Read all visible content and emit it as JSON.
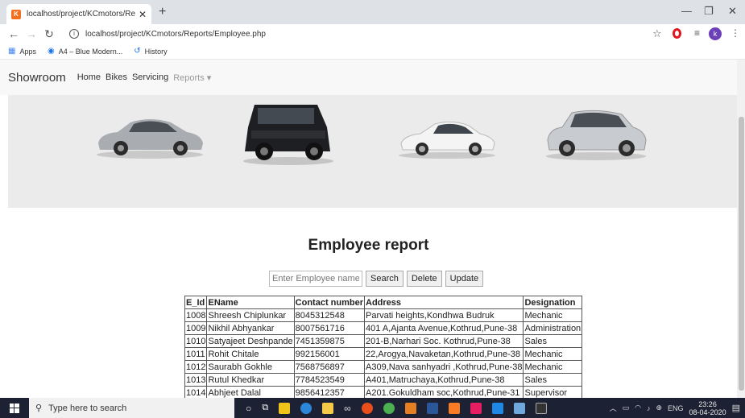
{
  "browser": {
    "tab_title": "localhost/project/KCmotors/Rep",
    "favicon_text": "K",
    "url": "localhost/project/KCmotors/Reports/Employee.php",
    "avatar_letter": "k",
    "bookmarks": [
      {
        "icon": "apps-grid-icon",
        "label": "Apps"
      },
      {
        "icon": "bookmark-site-icon",
        "label": "A4 – Blue Modern..."
      },
      {
        "icon": "history-icon",
        "label": "History"
      }
    ]
  },
  "navbar": {
    "brand": "Showroom",
    "links": [
      "Home",
      "Bikes",
      "Servicing"
    ],
    "dropdown": "Reports"
  },
  "report": {
    "title": "Employee report",
    "search_placeholder": "Enter Employee name",
    "buttons": {
      "search": "Search",
      "delete": "Delete",
      "update": "Update"
    },
    "columns": [
      "E_Id",
      "EName",
      "Contact number",
      "Address",
      "Designation"
    ],
    "rows": [
      [
        "1008",
        "Shreesh Chiplunkar",
        "8045312548",
        "Parvati heights,Kondhwa Budruk",
        "Mechanic"
      ],
      [
        "1009",
        "Nikhil Abhyankar",
        "8007561716",
        "401 A,Ajanta Avenue,Kothrud,Pune-38",
        "Administration"
      ],
      [
        "1010",
        "Satyajeet Deshpande",
        "7451359875",
        "201-B,Narhari Soc. Kothrud,Pune-38",
        "Sales"
      ],
      [
        "1011",
        "Rohit Chitale",
        "992156001",
        "22,Arogya,Navaketan,Kothrud,Pune-38",
        "Mechanic"
      ],
      [
        "1012",
        "Saurabh Gokhle",
        "7568756897",
        "A309,Nava sanhyadri ,Kothrud,Pune-38",
        "Mechanic"
      ],
      [
        "1013",
        "Rutul Khedkar",
        "7784523549",
        "A401,Matruchaya,Kothrud,Pune-38",
        "Sales"
      ],
      [
        "1014",
        "Abhjeet Dalal",
        "9856412357",
        "A201.Gokuldham soc,Kothrud,Pune-31",
        "Supervisor"
      ]
    ]
  },
  "taskbar": {
    "search_placeholder": "Type here to search",
    "lang": "ENG",
    "time": "23:26",
    "date": "08-04-2020"
  },
  "colors": {
    "accent_orange": "#f37021",
    "taskbar": "#1c2233",
    "navbar": "#f8f8f8"
  }
}
